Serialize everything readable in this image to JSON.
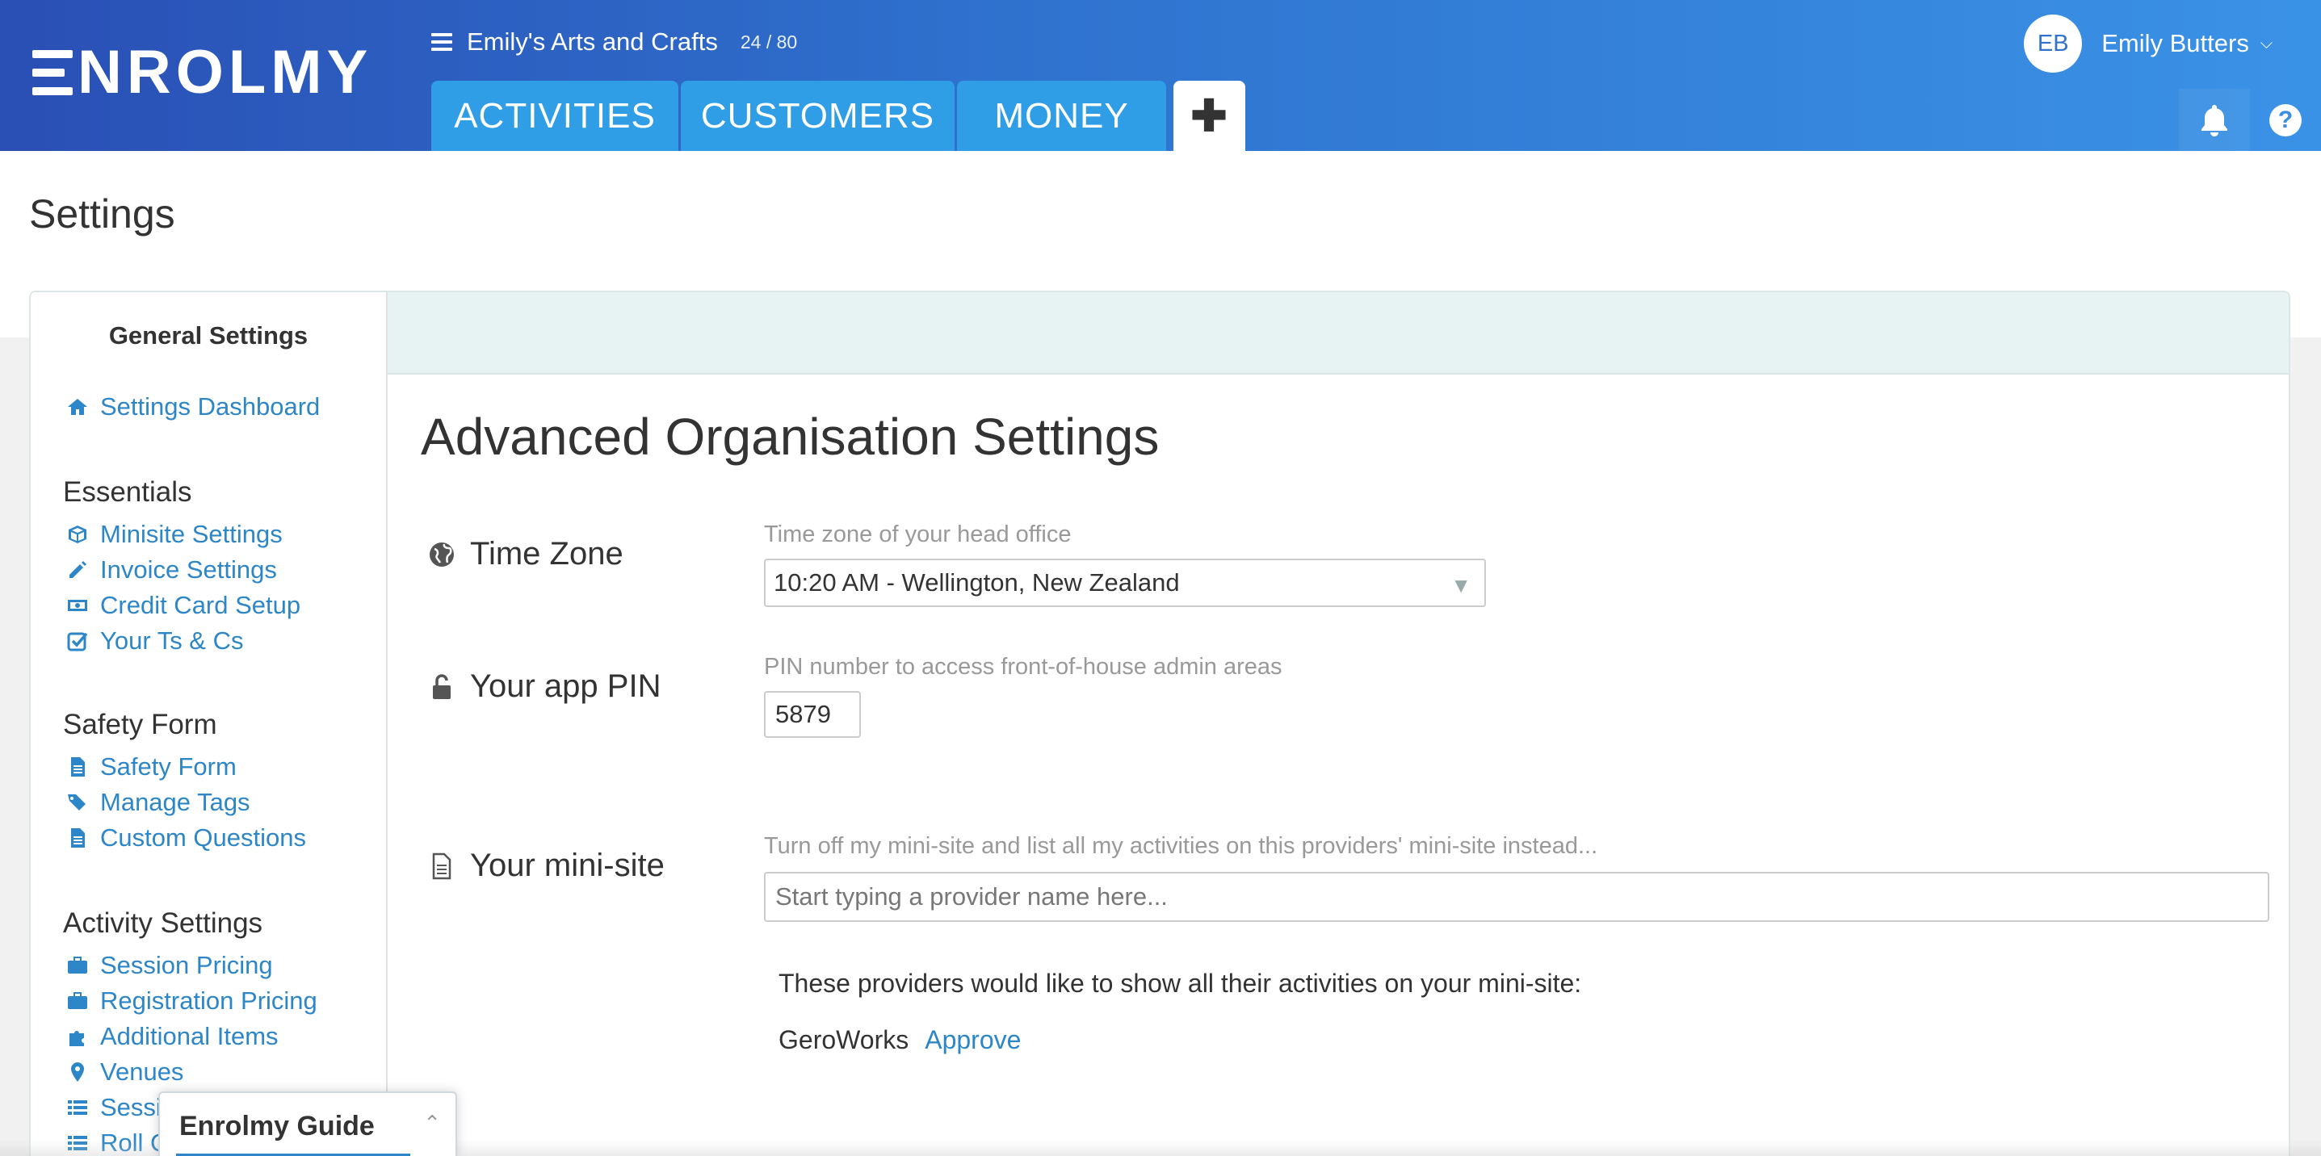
{
  "brand": {
    "logo_text": "NROLMY",
    "primary_color": "#2f73cf",
    "link_color": "#2d86c7"
  },
  "header": {
    "org_name": "Emily's Arts and Crafts",
    "org_count": "24 / 80",
    "tabs": [
      {
        "label": "ACTIVITIES"
      },
      {
        "label": "CUSTOMERS"
      },
      {
        "label": "MONEY"
      }
    ],
    "add_tab_label": "✚",
    "user": {
      "initials": "EB",
      "name": "Emily Butters"
    },
    "icons": [
      "menu-icon",
      "bell-icon",
      "help-icon",
      "chevron-down-icon"
    ]
  },
  "page": {
    "title": "Settings"
  },
  "sidebar": {
    "title": "General Settings",
    "dashboard": {
      "label": "Settings Dashboard",
      "icon": "home-icon"
    },
    "sections": [
      {
        "heading": "Essentials",
        "items": [
          {
            "label": "Minisite Settings",
            "icon": "cube-icon"
          },
          {
            "label": "Invoice Settings",
            "icon": "pencil-icon"
          },
          {
            "label": "Credit Card Setup",
            "icon": "money-icon"
          },
          {
            "label": "Your Ts & Cs",
            "icon": "check-square-icon"
          }
        ]
      },
      {
        "heading": "Safety Form",
        "items": [
          {
            "label": "Safety Form",
            "icon": "document-icon"
          },
          {
            "label": "Manage Tags",
            "icon": "tags-icon"
          },
          {
            "label": "Custom Questions",
            "icon": "document-icon"
          }
        ]
      },
      {
        "heading": "Activity Settings",
        "items": [
          {
            "label": "Session Pricing",
            "icon": "briefcase-icon"
          },
          {
            "label": "Registration Pricing",
            "icon": "briefcase-icon"
          },
          {
            "label": "Additional Items",
            "icon": "puzzle-icon"
          },
          {
            "label": "Venues",
            "icon": "map-marker-icon"
          },
          {
            "label": "Sessi",
            "icon": "list-icon"
          },
          {
            "label": "Roll C",
            "icon": "list-icon"
          }
        ]
      }
    ]
  },
  "main": {
    "title": "Advanced Organisation Settings",
    "time_zone": {
      "label": "Time Zone",
      "help": "Time zone of your head office",
      "value": "10:20 AM - Wellington, New Zealand"
    },
    "app_pin": {
      "label": "Your app PIN",
      "help": "PIN number to access front-of-house admin areas",
      "value": "5879"
    },
    "minisite": {
      "label": "Your mini-site",
      "help": "Turn off my mini-site and list all my activities on this providers' mini-site instead...",
      "placeholder": "Start typing a provider name here...",
      "providers_note": "These providers would like to show all their activities on your mini-site:",
      "providers": [
        {
          "name": "GeroWorks",
          "action": "Approve"
        }
      ]
    }
  },
  "guide": {
    "title": "Enrolmy Guide"
  }
}
